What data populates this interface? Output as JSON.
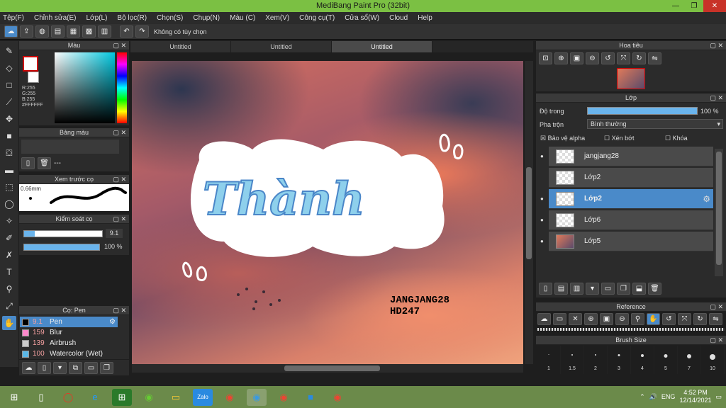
{
  "window": {
    "title": "MediBang Paint Pro (32bit)",
    "min": "—",
    "max": "❐",
    "close": "✕"
  },
  "menu": [
    "Tệp(F)",
    "Chỉnh sửa(E)",
    "Lớp(L)",
    "Bộ lọc(R)",
    "Chọn(S)",
    "Chụp(N)",
    "Màu (C)",
    "Xem(V)",
    "Công cụ(T)",
    "Cửa sổ(W)",
    "Cloud",
    "Help"
  ],
  "toolbar": {
    "hint": "Không có tùy chọn"
  },
  "panels": {
    "color": {
      "title": "Màu",
      "rgb": "R:255\nG:255\nB:255\n#FFFFFF"
    },
    "palette": {
      "title": "Bảng màu",
      "dash": "---"
    },
    "brush_preview": {
      "title": "Xem trước cọ",
      "size": "0.66mm"
    },
    "brush_control": {
      "title": "Kiểm soát cọ",
      "size": "9.1",
      "opacity": "100 %"
    },
    "brush_list": {
      "title": "Cọ: Pen"
    },
    "navigator": {
      "title": "Hoa tiêu"
    },
    "layers": {
      "title": "Lớp",
      "opacity_label": "Độ trong",
      "opacity_value": "100 %",
      "blend_label": "Pha trộn",
      "blend_value": "Bình thường",
      "protect_alpha": "Bảo vệ alpha",
      "clipping": "Xén bớt",
      "lock": "Khóa"
    },
    "reference": {
      "title": "Reference"
    },
    "brush_size": {
      "title": "Brush Size"
    }
  },
  "tabs": [
    "Untitled",
    "Untitled",
    "Untitled"
  ],
  "canvas": {
    "word": "Thành",
    "credit1": "JANGJANG28",
    "credit2": "HD247"
  },
  "layers": [
    {
      "name": "jangjang28",
      "thumb": "text"
    },
    {
      "name": "Lớp2",
      "thumb": "blank"
    },
    {
      "name": "Lớp2",
      "thumb": "blank",
      "selected": true
    },
    {
      "name": "Lớp6",
      "thumb": "blank"
    },
    {
      "name": "Lớp5",
      "thumb": "photo"
    }
  ],
  "brushes": [
    {
      "size": "9.1",
      "name": "Pen",
      "color": "#000000",
      "selected": true
    },
    {
      "size": "159",
      "name": "Blur",
      "color": "#ff88cc"
    },
    {
      "size": "139",
      "name": "Airbrush",
      "color": "#cccccc"
    },
    {
      "size": "100",
      "name": "Watercolor (Wet)",
      "color": "#5ab8e8"
    }
  ],
  "brush_sizes": [
    "1",
    "1.5",
    "2",
    "3",
    "4",
    "5",
    "7",
    "10"
  ],
  "taskbar": {
    "lang": "ENG",
    "time": "4:52 PM",
    "date": "12/14/2021"
  },
  "colors": {
    "accent": "#4a8ac9",
    "titlebar": "#7bc043"
  }
}
